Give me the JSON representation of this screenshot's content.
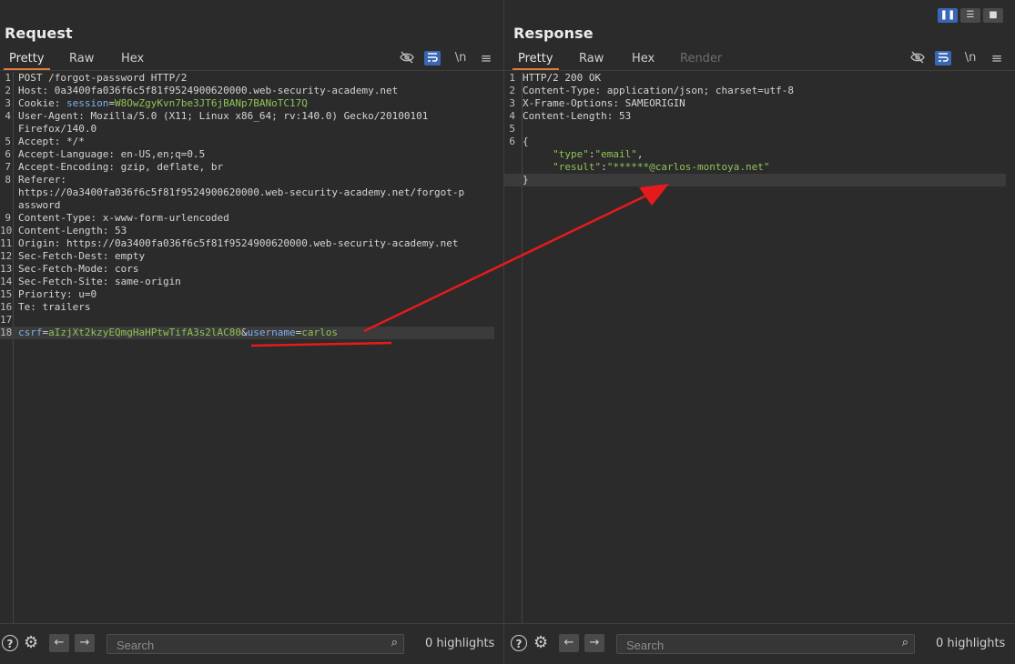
{
  "request": {
    "title": "Request",
    "tabs": [
      "Pretty",
      "Raw",
      "Hex"
    ],
    "active_tab": "Pretty",
    "tools": [
      "eye-off-icon",
      "wrap-icon",
      "newline-icon",
      "menu-icon"
    ],
    "newline_label": "\\n",
    "lines": [
      {
        "n": "1",
        "parts": [
          {
            "t": "POST /forgot-password HTTP/2",
            "c": "k"
          }
        ]
      },
      {
        "n": "2",
        "parts": [
          {
            "t": "Host: ",
            "c": "k"
          },
          {
            "t": "0a3400fa036f6c5f81f9524900620000.web-security-academy.net",
            "c": "k"
          }
        ]
      },
      {
        "n": "3",
        "parts": [
          {
            "t": "Cookie: ",
            "c": "k"
          },
          {
            "t": "session",
            "c": "blue"
          },
          {
            "t": "=",
            "c": "k"
          },
          {
            "t": "W8OwZgyKvn7be3JT6jBANp7BANoTC17Q",
            "c": "g"
          }
        ]
      },
      {
        "n": "4",
        "parts": [
          {
            "t": "User-Agent: Mozilla/5.0 (X11; Linux x86_64; rv:140.0) Gecko/20100101",
            "c": "k"
          }
        ]
      },
      {
        "n": "",
        "parts": [
          {
            "t": "Firefox/140.0",
            "c": "k"
          }
        ]
      },
      {
        "n": "5",
        "parts": [
          {
            "t": "Accept: */*",
            "c": "k"
          }
        ]
      },
      {
        "n": "6",
        "parts": [
          {
            "t": "Accept-Language: en-US,en;q=0.5",
            "c": "k"
          }
        ]
      },
      {
        "n": "7",
        "parts": [
          {
            "t": "Accept-Encoding: gzip, deflate, br",
            "c": "k"
          }
        ]
      },
      {
        "n": "8",
        "parts": [
          {
            "t": "Referer:",
            "c": "k"
          }
        ]
      },
      {
        "n": "",
        "parts": [
          {
            "t": "https://0a3400fa036f6c5f81f9524900620000.web-security-academy.net/forgot-p",
            "c": "k"
          }
        ]
      },
      {
        "n": "",
        "parts": [
          {
            "t": "assword",
            "c": "k"
          }
        ]
      },
      {
        "n": "9",
        "parts": [
          {
            "t": "Content-Type: x-www-form-urlencoded",
            "c": "k"
          }
        ]
      },
      {
        "n": "10",
        "parts": [
          {
            "t": "Content-Length: 53",
            "c": "k"
          }
        ]
      },
      {
        "n": "11",
        "parts": [
          {
            "t": "Origin: https://0a3400fa036f6c5f81f9524900620000.web-security-academy.net",
            "c": "k"
          }
        ]
      },
      {
        "n": "12",
        "parts": [
          {
            "t": "Sec-Fetch-Dest: empty",
            "c": "k"
          }
        ]
      },
      {
        "n": "13",
        "parts": [
          {
            "t": "Sec-Fetch-Mode: cors",
            "c": "k"
          }
        ]
      },
      {
        "n": "14",
        "parts": [
          {
            "t": "Sec-Fetch-Site: same-origin",
            "c": "k"
          }
        ]
      },
      {
        "n": "15",
        "parts": [
          {
            "t": "Priority: u=0",
            "c": "k"
          }
        ]
      },
      {
        "n": "16",
        "parts": [
          {
            "t": "Te: trailers",
            "c": "k"
          }
        ]
      },
      {
        "n": "17",
        "parts": []
      },
      {
        "n": "18",
        "highlight": true,
        "parts": [
          {
            "t": "csrf",
            "c": "blue"
          },
          {
            "t": "=",
            "c": "k"
          },
          {
            "t": "aIzjXt2kzyEQmgHaHPtwTifA3s2lAC80",
            "c": "g"
          },
          {
            "t": "&",
            "c": "k"
          },
          {
            "t": "username",
            "c": "blue"
          },
          {
            "t": "=",
            "c": "k"
          },
          {
            "t": "carlos",
            "c": "g"
          }
        ]
      }
    ],
    "search_placeholder": "Search",
    "highlights": "0 highlights"
  },
  "response": {
    "title": "Response",
    "tabs": [
      "Pretty",
      "Raw",
      "Hex",
      "Render"
    ],
    "active_tab": "Pretty",
    "disabled_tab": "Render",
    "newline_label": "\\n",
    "lines": [
      {
        "n": "1",
        "parts": [
          {
            "t": "HTTP/2 200 OK",
            "c": "k"
          }
        ]
      },
      {
        "n": "2",
        "parts": [
          {
            "t": "Content-Type: application/json; charset=utf-8",
            "c": "k"
          }
        ]
      },
      {
        "n": "3",
        "parts": [
          {
            "t": "X-Frame-Options: SAMEORIGIN",
            "c": "k"
          }
        ]
      },
      {
        "n": "4",
        "parts": [
          {
            "t": "Content-Length: 53",
            "c": "k"
          }
        ]
      },
      {
        "n": "5",
        "parts": []
      },
      {
        "n": "6",
        "parts": [
          {
            "t": "{",
            "c": "k"
          }
        ]
      },
      {
        "n": "",
        "parts": [
          {
            "t": "     \"type\"",
            "c": "g"
          },
          {
            "t": ":",
            "c": "k"
          },
          {
            "t": "\"email\"",
            "c": "g"
          },
          {
            "t": ",",
            "c": "k"
          }
        ]
      },
      {
        "n": "",
        "parts": [
          {
            "t": "     \"result\"",
            "c": "g"
          },
          {
            "t": ":",
            "c": "k"
          },
          {
            "t": "\"******@carlos-montoya.net\"",
            "c": "g"
          }
        ]
      },
      {
        "n": "",
        "highlight": true,
        "parts": [
          {
            "t": "}",
            "c": "k"
          }
        ]
      }
    ],
    "search_placeholder": "Search",
    "highlights": "0 highlights"
  },
  "bottom": {
    "help_label": "?",
    "back_label": "←",
    "forward_label": "→"
  },
  "annotation": {
    "arrow_color": "#e51b1b"
  }
}
